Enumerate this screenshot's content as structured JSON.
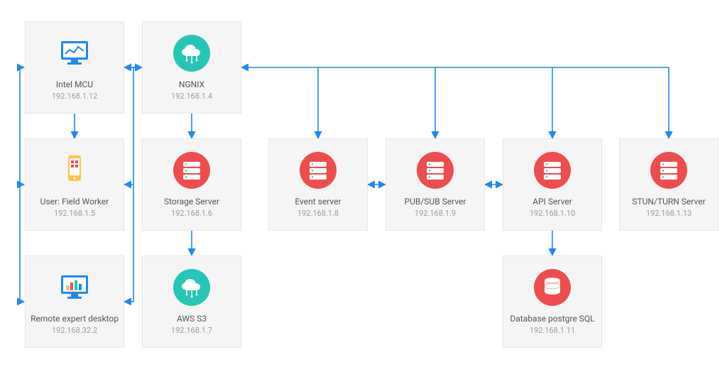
{
  "colors": {
    "teal": "#25c6b7",
    "red": "#ef4d4d",
    "blue": "#1e88f4",
    "icon_white": "#ffffff",
    "icon_yellow": "#ffc44d",
    "icon_teal_light": "#6fe0d4"
  },
  "nodes": {
    "intel_mcu": {
      "title": "Intel MCU",
      "ip": "192.168.1.12",
      "icon": "monitor-chart"
    },
    "nginx": {
      "title": "NGNIX",
      "ip": "192.168.1.4",
      "icon": "cloud"
    },
    "field_worker": {
      "title": "User: Field Worker",
      "ip": "192.168.1.5",
      "icon": "phone"
    },
    "storage": {
      "title": "Storage Server",
      "ip": "192.168.1.6",
      "icon": "server"
    },
    "remote_desktop": {
      "title": "Remote expert desktop",
      "ip": "192.168.32.2",
      "icon": "monitor-bars"
    },
    "aws_s3": {
      "title": "AWS S3",
      "ip": "192.168.1.7",
      "icon": "cloud"
    },
    "event": {
      "title": "Event server",
      "ip": "192.168.1.8",
      "icon": "server"
    },
    "pubsub": {
      "title": "PUB/SUB Server",
      "ip": "192.168.1.9",
      "icon": "server"
    },
    "api": {
      "title": "API Server",
      "ip": "192.168.1.10",
      "icon": "server"
    },
    "stun": {
      "title": "STUN/TURN Server",
      "ip": "192.168.1.13",
      "icon": "server"
    },
    "db": {
      "title": "Database postgre SQL",
      "ip": "192.168.1.11",
      "icon": "database"
    }
  }
}
